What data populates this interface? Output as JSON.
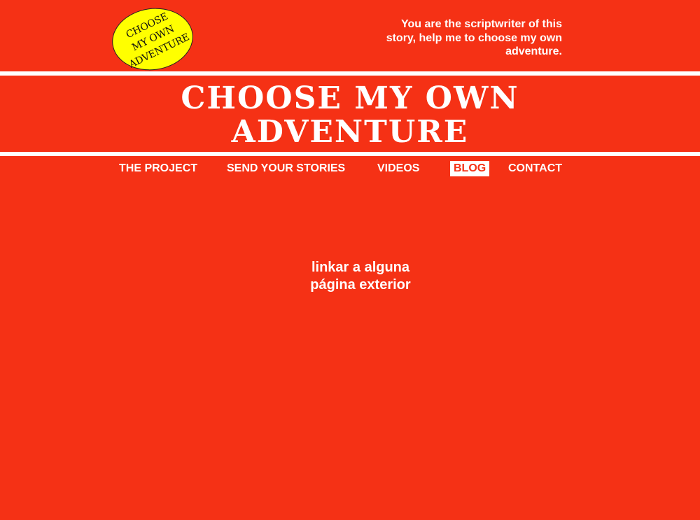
{
  "logo": {
    "line1": "CHOOSE",
    "line2": "MY OWN",
    "line3": "ADVENTURE"
  },
  "header": {
    "tagline": "You are the scriptwriter of this story, help me to choose my own adventure.",
    "title_line1": "CHOOSE  MY OWN",
    "title_line2": "ADVENTURE"
  },
  "nav": {
    "items": [
      {
        "label": "THE PROJECT"
      },
      {
        "label": "SEND YOUR STORIES"
      },
      {
        "label": "VIDEOS"
      },
      {
        "label": "BLOG",
        "active": true
      },
      {
        "label": "CONTACT"
      }
    ]
  },
  "main": {
    "line1": "linkar a alguna",
    "line2": "página exterior"
  },
  "colors": {
    "background": "#f53115",
    "logo_fill": "#ffff00",
    "text": "#ffffff"
  }
}
